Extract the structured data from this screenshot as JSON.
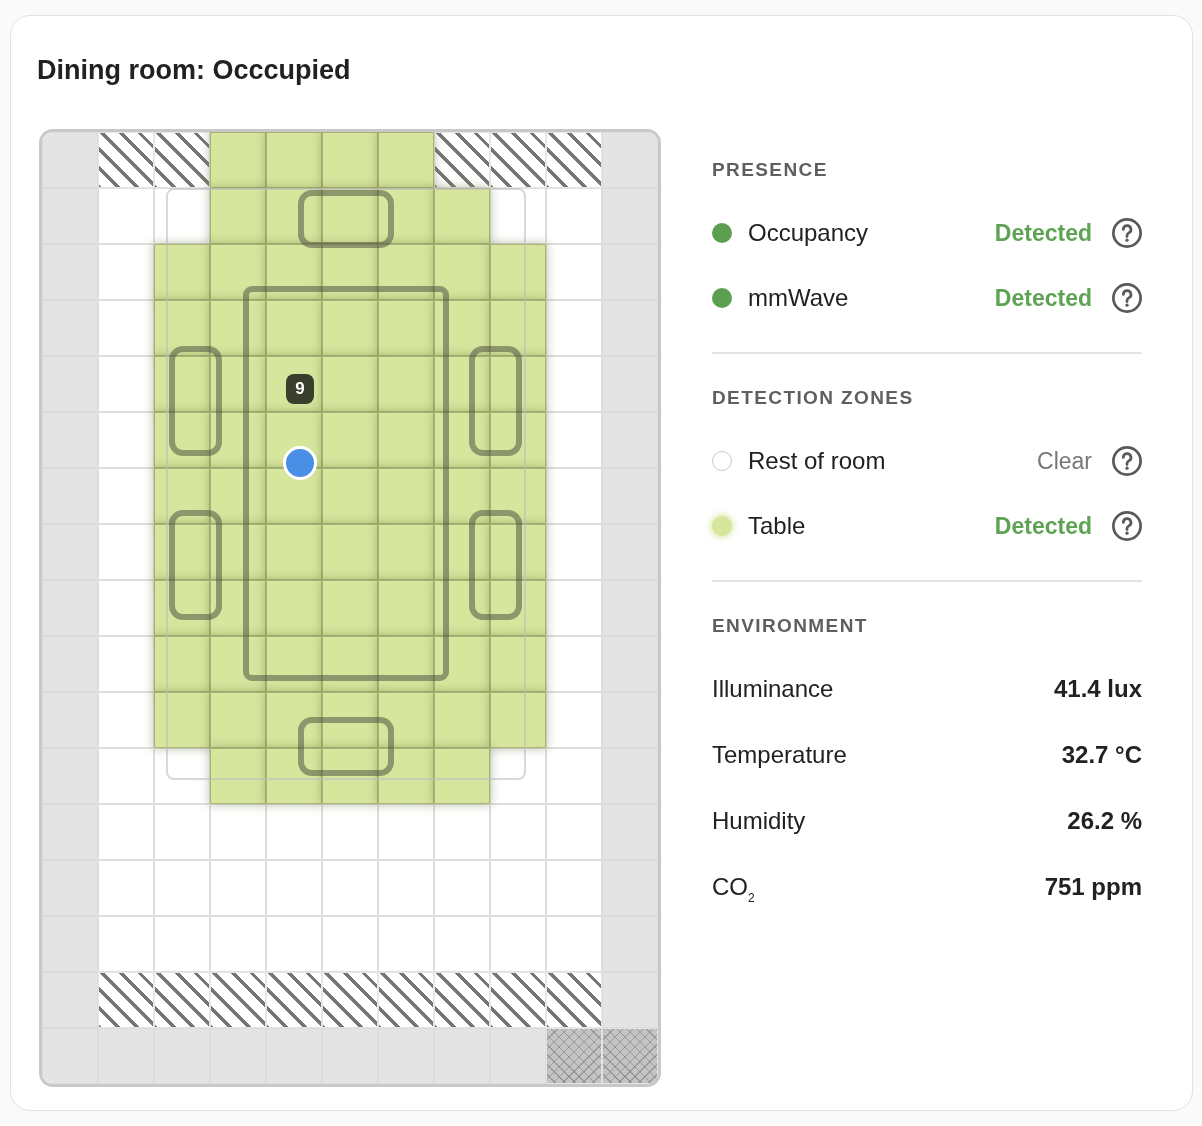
{
  "title": "Dining room: Occcupied",
  "map": {
    "rows": [
      [
        {
          "kind": "edge"
        },
        {
          "kind": "blocked"
        },
        {
          "kind": "blocked"
        },
        {
          "kind": "zone"
        },
        {
          "kind": "zone"
        },
        {
          "kind": "zone"
        },
        {
          "kind": "zone"
        },
        {
          "kind": "blocked"
        },
        {
          "kind": "blocked"
        },
        {
          "kind": "blocked"
        },
        {
          "kind": "edge"
        }
      ],
      [
        {
          "kind": "edge"
        },
        {
          "kind": "floor"
        },
        {
          "kind": "floor"
        },
        {
          "kind": "zone"
        },
        {
          "kind": "zone"
        },
        {
          "kind": "zone"
        },
        {
          "kind": "zone"
        },
        {
          "kind": "zone"
        },
        {
          "kind": "floor"
        },
        {
          "kind": "floor"
        },
        {
          "kind": "edge"
        }
      ],
      [
        {
          "kind": "edge"
        },
        {
          "kind": "floor"
        },
        {
          "kind": "zone"
        },
        {
          "kind": "zone"
        },
        {
          "kind": "zone"
        },
        {
          "kind": "zone"
        },
        {
          "kind": "zone"
        },
        {
          "kind": "zone"
        },
        {
          "kind": "zone"
        },
        {
          "kind": "floor"
        },
        {
          "kind": "edge"
        }
      ],
      [
        {
          "kind": "edge"
        },
        {
          "kind": "floor"
        },
        {
          "kind": "zone"
        },
        {
          "kind": "zone"
        },
        {
          "kind": "zone"
        },
        {
          "kind": "zone"
        },
        {
          "kind": "zone"
        },
        {
          "kind": "zone"
        },
        {
          "kind": "zone"
        },
        {
          "kind": "floor"
        },
        {
          "kind": "edge"
        }
      ],
      [
        {
          "kind": "edge"
        },
        {
          "kind": "floor"
        },
        {
          "kind": "zone"
        },
        {
          "kind": "zone"
        },
        {
          "kind": "zone"
        },
        {
          "kind": "zone"
        },
        {
          "kind": "zone"
        },
        {
          "kind": "zone"
        },
        {
          "kind": "zone"
        },
        {
          "kind": "floor"
        },
        {
          "kind": "edge"
        }
      ],
      [
        {
          "kind": "edge"
        },
        {
          "kind": "floor"
        },
        {
          "kind": "zone"
        },
        {
          "kind": "zone"
        },
        {
          "kind": "zone"
        },
        {
          "kind": "zone"
        },
        {
          "kind": "zone"
        },
        {
          "kind": "zone"
        },
        {
          "kind": "zone"
        },
        {
          "kind": "floor"
        },
        {
          "kind": "edge"
        }
      ],
      [
        {
          "kind": "edge"
        },
        {
          "kind": "floor"
        },
        {
          "kind": "zone"
        },
        {
          "kind": "zone"
        },
        {
          "kind": "zone"
        },
        {
          "kind": "zone"
        },
        {
          "kind": "zone"
        },
        {
          "kind": "zone"
        },
        {
          "kind": "zone"
        },
        {
          "kind": "floor"
        },
        {
          "kind": "edge"
        }
      ],
      [
        {
          "kind": "edge"
        },
        {
          "kind": "floor"
        },
        {
          "kind": "zone"
        },
        {
          "kind": "zone"
        },
        {
          "kind": "zone"
        },
        {
          "kind": "zone"
        },
        {
          "kind": "zone"
        },
        {
          "kind": "zone"
        },
        {
          "kind": "zone"
        },
        {
          "kind": "floor"
        },
        {
          "kind": "edge"
        }
      ],
      [
        {
          "kind": "edge"
        },
        {
          "kind": "floor"
        },
        {
          "kind": "zone"
        },
        {
          "kind": "zone"
        },
        {
          "kind": "zone"
        },
        {
          "kind": "zone"
        },
        {
          "kind": "zone"
        },
        {
          "kind": "zone"
        },
        {
          "kind": "zone"
        },
        {
          "kind": "floor"
        },
        {
          "kind": "edge"
        }
      ],
      [
        {
          "kind": "edge"
        },
        {
          "kind": "floor"
        },
        {
          "kind": "zone"
        },
        {
          "kind": "zone"
        },
        {
          "kind": "zone"
        },
        {
          "kind": "zone"
        },
        {
          "kind": "zone"
        },
        {
          "kind": "zone"
        },
        {
          "kind": "zone"
        },
        {
          "kind": "floor"
        },
        {
          "kind": "edge"
        }
      ],
      [
        {
          "kind": "edge"
        },
        {
          "kind": "floor"
        },
        {
          "kind": "zone"
        },
        {
          "kind": "zone"
        },
        {
          "kind": "zone"
        },
        {
          "kind": "zone"
        },
        {
          "kind": "zone"
        },
        {
          "kind": "zone"
        },
        {
          "kind": "zone"
        },
        {
          "kind": "floor"
        },
        {
          "kind": "edge"
        }
      ],
      [
        {
          "kind": "edge"
        },
        {
          "kind": "floor"
        },
        {
          "kind": "floor"
        },
        {
          "kind": "zone"
        },
        {
          "kind": "zone"
        },
        {
          "kind": "zone"
        },
        {
          "kind": "zone"
        },
        {
          "kind": "zone"
        },
        {
          "kind": "floor"
        },
        {
          "kind": "floor"
        },
        {
          "kind": "edge"
        }
      ],
      [
        {
          "kind": "edge"
        },
        {
          "kind": "floor"
        },
        {
          "kind": "floor"
        },
        {
          "kind": "floor"
        },
        {
          "kind": "floor"
        },
        {
          "kind": "floor"
        },
        {
          "kind": "floor"
        },
        {
          "kind": "floor"
        },
        {
          "kind": "floor"
        },
        {
          "kind": "floor"
        },
        {
          "kind": "edge"
        }
      ],
      [
        {
          "kind": "edge"
        },
        {
          "kind": "floor"
        },
        {
          "kind": "floor"
        },
        {
          "kind": "floor"
        },
        {
          "kind": "floor"
        },
        {
          "kind": "floor"
        },
        {
          "kind": "floor"
        },
        {
          "kind": "floor"
        },
        {
          "kind": "floor"
        },
        {
          "kind": "floor"
        },
        {
          "kind": "edge"
        }
      ],
      [
        {
          "kind": "edge"
        },
        {
          "kind": "floor"
        },
        {
          "kind": "floor"
        },
        {
          "kind": "floor"
        },
        {
          "kind": "floor"
        },
        {
          "kind": "floor"
        },
        {
          "kind": "floor"
        },
        {
          "kind": "floor"
        },
        {
          "kind": "floor"
        },
        {
          "kind": "floor"
        },
        {
          "kind": "edge"
        }
      ],
      [
        {
          "kind": "edge"
        },
        {
          "kind": "blocked"
        },
        {
          "kind": "blocked"
        },
        {
          "kind": "blocked"
        },
        {
          "kind": "blocked"
        },
        {
          "kind": "blocked"
        },
        {
          "kind": "blocked"
        },
        {
          "kind": "blocked"
        },
        {
          "kind": "blocked"
        },
        {
          "kind": "blocked"
        },
        {
          "kind": "edge"
        }
      ],
      [
        {
          "kind": "edge"
        },
        {
          "kind": "edge"
        },
        {
          "kind": "edge"
        },
        {
          "kind": "edge"
        },
        {
          "kind": "edge"
        },
        {
          "kind": "edge"
        },
        {
          "kind": "edge"
        },
        {
          "kind": "edge"
        },
        {
          "kind": "edge"
        },
        {
          "kind": "excluded"
        },
        {
          "kind": "excluded"
        }
      ]
    ],
    "shapes": [
      {
        "kind": "zone_border"
      },
      {
        "kind": "chair"
      },
      {
        "kind": "table"
      },
      {
        "kind": "chair"
      },
      {
        "kind": "chair"
      },
      {
        "kind": "chair"
      },
      {
        "kind": "chair"
      },
      {
        "kind": "chair"
      }
    ],
    "targets": [
      {
        "kind": "badge",
        "label": "9"
      },
      {
        "kind": "dot"
      }
    ]
  },
  "presence": {
    "heading": "PRESENCE",
    "items": [
      {
        "name": "Occupancy",
        "status": "Detected",
        "detected": true
      },
      {
        "name": "mmWave",
        "status": "Detected",
        "detected": true
      }
    ]
  },
  "zones": {
    "heading": "DETECTION ZONES",
    "items": [
      {
        "name": "Rest of room",
        "status": "Clear",
        "detected": false
      },
      {
        "name": "Table",
        "status": "Detected",
        "detected": true,
        "color": "#d7e69d"
      }
    ]
  },
  "environment": {
    "heading": "ENVIRONMENT",
    "items": [
      {
        "name": "Illuminance",
        "value": "41.4 lux"
      },
      {
        "name": "Temperature",
        "value": "32.7 °C"
      },
      {
        "name": "Humidity",
        "value": "26.2 %"
      },
      {
        "name": "CO$_{2}$",
        "value": "751 ppm"
      }
    ]
  }
}
